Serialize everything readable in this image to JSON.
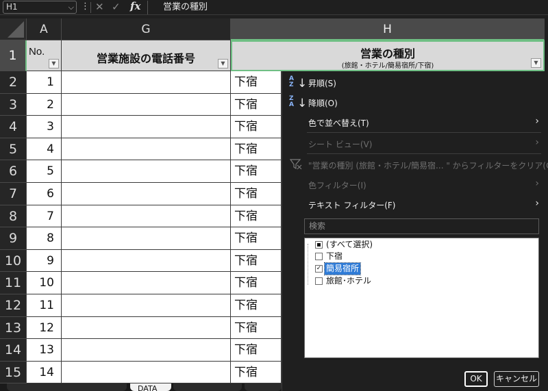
{
  "formula_bar": {
    "name_box": "H1",
    "fx_label": "fx",
    "content": "営業の種別"
  },
  "columns": [
    {
      "letter": "A"
    },
    {
      "letter": "G"
    },
    {
      "letter": "H"
    }
  ],
  "header_row": {
    "no_label": "No.",
    "phone_label": "営業施設の電話番号",
    "type_title": "営業の種別",
    "type_subtitle": "(旅館・ホテル/簡易宿所/下宿)"
  },
  "rows": [
    {
      "row": "2",
      "no": "1",
      "type": "下宿"
    },
    {
      "row": "3",
      "no": "2",
      "type": "下宿"
    },
    {
      "row": "4",
      "no": "3",
      "type": "下宿"
    },
    {
      "row": "5",
      "no": "4",
      "type": "下宿"
    },
    {
      "row": "6",
      "no": "5",
      "type": "下宿"
    },
    {
      "row": "7",
      "no": "6",
      "type": "下宿"
    },
    {
      "row": "8",
      "no": "7",
      "type": "下宿"
    },
    {
      "row": "9",
      "no": "8",
      "type": "下宿"
    },
    {
      "row": "10",
      "no": "9",
      "type": "下宿"
    },
    {
      "row": "11",
      "no": "10",
      "type": "下宿"
    },
    {
      "row": "12",
      "no": "11",
      "type": "下宿"
    },
    {
      "row": "13",
      "no": "12",
      "type": "下宿"
    },
    {
      "row": "14",
      "no": "13",
      "type": "下宿"
    },
    {
      "row": "15",
      "no": "14",
      "type": "下宿"
    }
  ],
  "header_row_number": "1",
  "filter_menu": {
    "sort_asc": "昇順(S)",
    "sort_desc": "降順(O)",
    "sort_by_color": "色で並べ替え(T)",
    "sheet_view": "シート ビュー(V)",
    "clear_filter": "\"営業の種別 (旅館・ホテル/簡易宿... \" からフィルターをクリア(C)",
    "color_filter": "色フィルター(I)",
    "text_filter": "テキスト フィルター(F)",
    "search_placeholder": "検索",
    "items": [
      {
        "label": "(すべて選択)",
        "state": "mixed"
      },
      {
        "label": "下宿",
        "state": "unchecked"
      },
      {
        "label": "簡易宿所",
        "state": "checked"
      },
      {
        "label": "旅館･ホテル",
        "state": "unchecked"
      }
    ],
    "ok": "OK",
    "cancel": "キャンセル"
  },
  "sheet_tabs": {
    "active": "DATA"
  },
  "colors": {
    "selection_green": "#6fbf84",
    "highlight_blue": "#2f7bd6"
  }
}
